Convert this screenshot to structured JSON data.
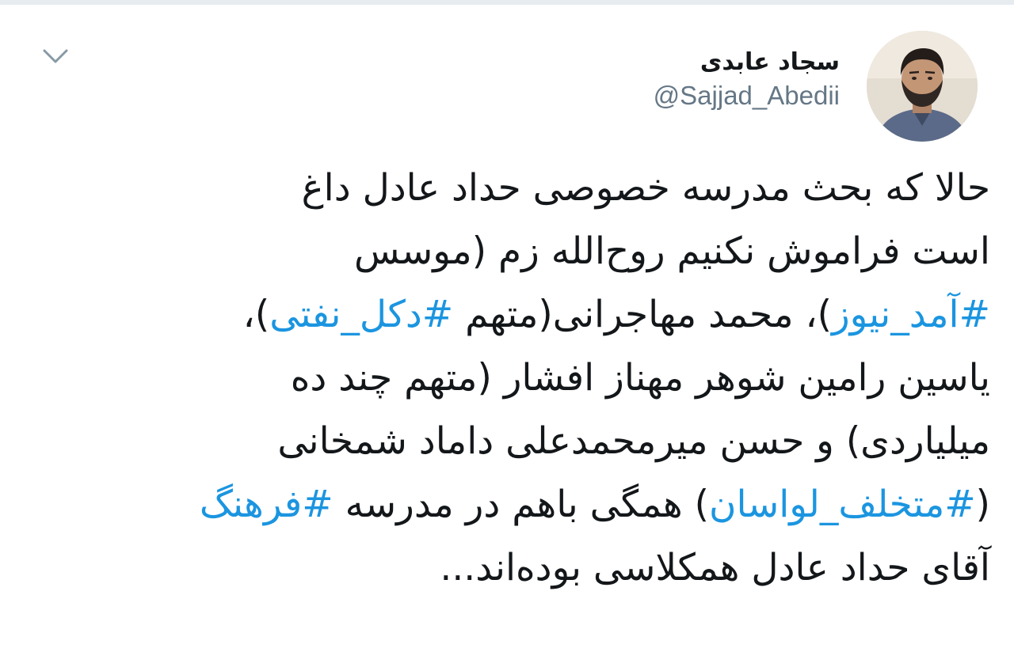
{
  "colors": {
    "text": "#14171a",
    "secondary": "#657786",
    "link": "#1b95e0",
    "background": "#ffffff"
  },
  "header": {
    "menu_icon": "chevron-down-icon",
    "display_name": "سجاد عابدی",
    "handle": "@Sajjad_Abedii",
    "avatar_icon": "profile-photo"
  },
  "tweet": {
    "line1": "حالا که بحث مدرسه خصوصی حداد عادل داغ",
    "line2": "است فراموش نکنیم روح‌الله زم (موسس",
    "line3": {
      "hashtag1": "#آمد_نیوز",
      "text1": ")، محمد مهاجرانی(متهم ",
      "hashtag2": "#دکل_نفتی",
      "text2": ")،"
    },
    "line4": "یاسین رامین شوهر مهناز افشار (متهم چند ده",
    "line5": "میلیاردی) و حسن میرمحمدعلی داماد شمخانی",
    "line6": {
      "text1": "(",
      "hashtag1": "#متخلف_لواسان",
      "text2": ") همگی باهم در مدرسه ",
      "hashtag2": "#فرهنگ"
    },
    "line7": "آقای حداد عادل همکلاسی بوده‌اند..."
  }
}
